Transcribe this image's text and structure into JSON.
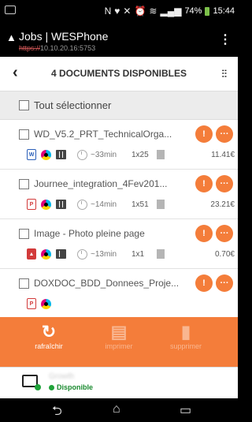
{
  "statusbar": {
    "icons": [
      "N",
      "♥",
      "✕",
      "⏰",
      "wifi",
      "signal"
    ],
    "battery": "74%",
    "time": "15:44"
  },
  "titlebar": {
    "title": "Jobs | WESPhone",
    "url_scheme": "https://",
    "url_host": "10.10.20.16:5753"
  },
  "header": {
    "title": "4 DOCUMENTS DISPONIBLES"
  },
  "select_all": "Tout sélectionner",
  "documents": [
    {
      "name": "WD_V5.2_PRT_TechnicalOrga...",
      "type": "word",
      "layout": "duplex",
      "duration": "~33min",
      "copies": "1x25",
      "price": "11.41€"
    },
    {
      "name": "Journee_integration_4Fev201...",
      "type": "pdf",
      "layout": "duplex",
      "duration": "~14min",
      "copies": "1x51",
      "price": "23.21€"
    },
    {
      "name": "Image - Photo pleine page",
      "type": "image",
      "layout": "single",
      "duration": "~13min",
      "copies": "1x1",
      "price": "0.70€"
    },
    {
      "name": "DOXDOC_BDD_Donnees_Proje...",
      "type": "pdf",
      "layout": "duplex",
      "duration": "",
      "copies": "",
      "price": ""
    }
  ],
  "toolbar": {
    "refresh": "rafraîchir",
    "print": "imprimer",
    "delete": "supprimer"
  },
  "printer": {
    "name": "Growth",
    "status": "Disponible"
  },
  "colors": {
    "accent": "#f47d3a",
    "available": "#1fa33a"
  }
}
